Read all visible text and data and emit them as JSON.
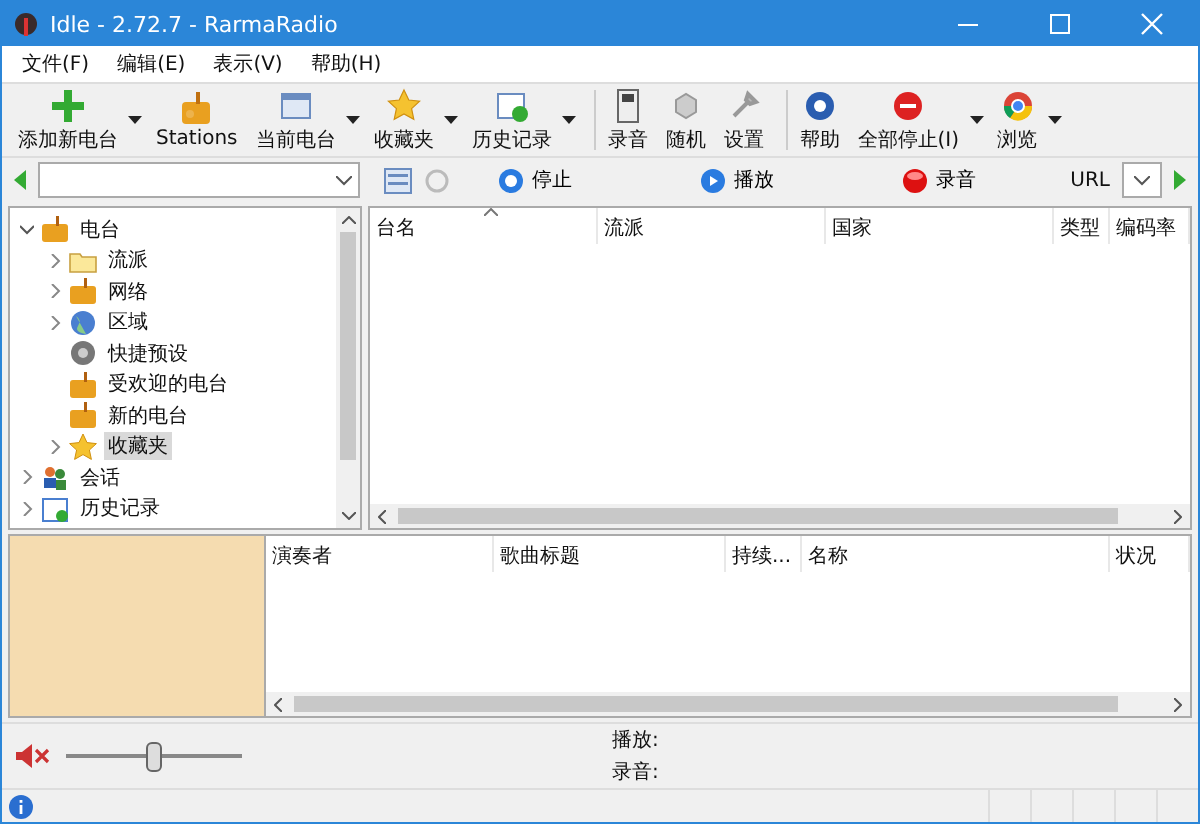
{
  "window": {
    "title": "Idle - 2.72.7 - RarmaRadio"
  },
  "menu": [
    {
      "label": "文件(F)"
    },
    {
      "label": "编辑(E)"
    },
    {
      "label": "表示(V)"
    },
    {
      "label": "帮助(H)"
    }
  ],
  "toolbar": [
    [
      {
        "label": "添加新电台",
        "dropdown": true
      },
      {
        "label": "Stations",
        "dropdown": false
      },
      {
        "label": "当前电台",
        "dropdown": true
      },
      {
        "label": "收藏夹",
        "dropdown": true
      },
      {
        "label": "历史记录",
        "dropdown": true
      }
    ],
    [
      {
        "label": "录音",
        "dropdown": false
      },
      {
        "label": "随机",
        "dropdown": false
      },
      {
        "label": "设置",
        "dropdown": false
      }
    ],
    [
      {
        "label": "帮助",
        "dropdown": false
      },
      {
        "label": "全部停止(I)",
        "dropdown": true
      },
      {
        "label": "浏览",
        "dropdown": true
      }
    ]
  ],
  "address_bar": {
    "buttons": [
      {
        "label": "停止"
      },
      {
        "label": "播放"
      },
      {
        "label": "录音"
      }
    ],
    "url_label": "URL"
  },
  "tree": [
    {
      "label": "电台",
      "expanded": true,
      "selected": false,
      "children": [
        {
          "label": "流派",
          "expanded": false,
          "selected": false
        },
        {
          "label": "网络",
          "expanded": false,
          "selected": false
        },
        {
          "label": "区域",
          "expanded": false,
          "selected": false
        },
        {
          "label": "快捷预设",
          "selected": false
        },
        {
          "label": "受欢迎的电台",
          "selected": false
        },
        {
          "label": "新的电台",
          "selected": false
        },
        {
          "label": "收藏夹",
          "expanded": false,
          "selected": true
        }
      ]
    },
    {
      "label": "会话",
      "expanded": false,
      "selected": false
    },
    {
      "label": "历史记录",
      "expanded": false,
      "selected": false
    }
  ],
  "stations_table": {
    "columns": [
      {
        "label": "台名",
        "sorted": true
      },
      {
        "label": "流派",
        "sorted": false
      },
      {
        "label": "国家",
        "sorted": false
      },
      {
        "label": "类型",
        "sorted": false
      },
      {
        "label": "编码率",
        "sorted": false
      }
    ]
  },
  "tracks_table": {
    "columns": [
      {
        "label": "演奏者"
      },
      {
        "label": "歌曲标题"
      },
      {
        "label": "持续..."
      },
      {
        "label": "名称"
      },
      {
        "label": "状况"
      }
    ]
  },
  "player": {
    "muted": true,
    "volume": {
      "level": 0.5
    },
    "play_label": "播放:",
    "record_label": "录音:"
  }
}
